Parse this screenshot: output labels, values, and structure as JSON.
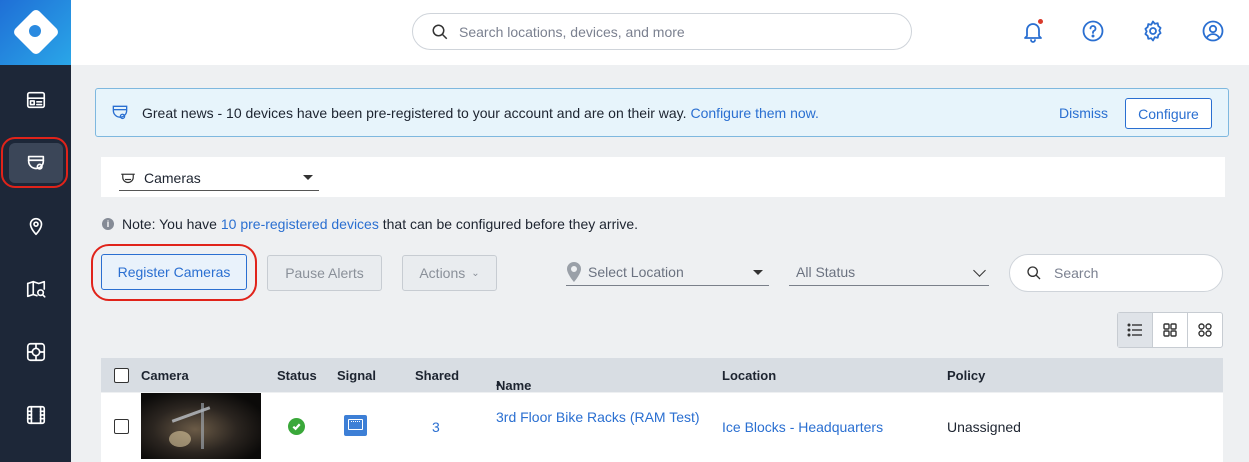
{
  "topbar": {
    "search_placeholder": "Search locations, devices, and more",
    "icons": [
      "bell-icon",
      "help-icon",
      "gear-icon",
      "user-icon"
    ]
  },
  "sidebar": {
    "items": [
      {
        "icon": "dashboard-icon"
      },
      {
        "icon": "camera-icon",
        "active": true
      },
      {
        "icon": "location-pin-icon"
      },
      {
        "icon": "map-search-icon"
      },
      {
        "icon": "analytics-icon"
      },
      {
        "icon": "film-icon"
      }
    ]
  },
  "banner": {
    "message": "Great news - 10 devices have been pre-registered to your account and are on their way.",
    "link": "Configure them now.",
    "dismiss": "Dismiss",
    "configure": "Configure"
  },
  "device_type": {
    "selected": "Cameras"
  },
  "note": {
    "prefix": "Note: You have",
    "link": "10 pre-registered devices",
    "suffix": "that can be configured before they arrive."
  },
  "toolbar": {
    "register": "Register Cameras",
    "pause": "Pause Alerts",
    "actions": "Actions",
    "location_placeholder": "Select Location",
    "status_placeholder": "All Status",
    "search_placeholder": "Search"
  },
  "table": {
    "headers": {
      "camera": "Camera",
      "status": "Status",
      "signal": "Signal",
      "shared": "Shared",
      "name": "Name",
      "name_sort": "▴",
      "location": "Location",
      "policy": "Policy"
    },
    "rows": [
      {
        "shared": "3",
        "name": "3rd Floor Bike Racks (RAM Test)",
        "location": "Ice Blocks - Headquarters",
        "policy": "Unassigned"
      }
    ]
  },
  "colors": {
    "accent": "#2a6fd1",
    "sidebar": "#1d2738",
    "highlight_ring": "#e0231a",
    "status_ok": "#3aa83a"
  }
}
